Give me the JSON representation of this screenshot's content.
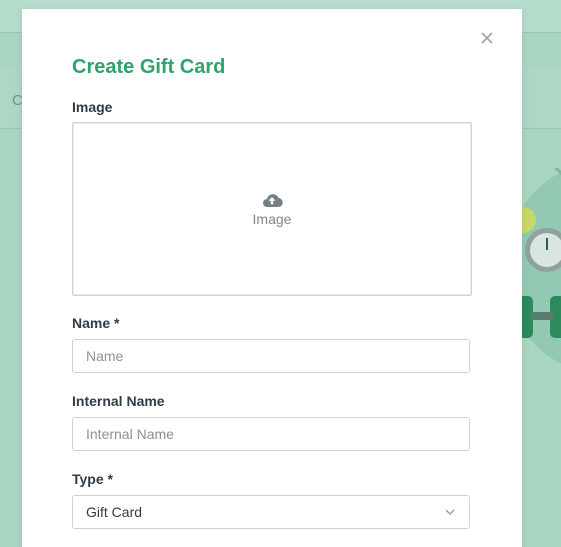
{
  "modal": {
    "title": "Create Gift Card",
    "close_icon": "close-icon",
    "image": {
      "label": "Image",
      "upload_text": "Image",
      "icon": "cloud-upload-icon"
    },
    "name": {
      "label": "Name *",
      "placeholder": "Name",
      "value": ""
    },
    "internal_name": {
      "label": "Internal Name",
      "placeholder": "Internal Name",
      "value": ""
    },
    "type": {
      "label": "Type *",
      "selected": "Gift Card",
      "icon": "chevron-down-icon"
    }
  },
  "background": {
    "partial_text": "C"
  },
  "colors": {
    "accent": "#2fa36c",
    "overlay": "#a9d6c2",
    "label": "#2f3b46",
    "border": "#cfd3d7"
  }
}
